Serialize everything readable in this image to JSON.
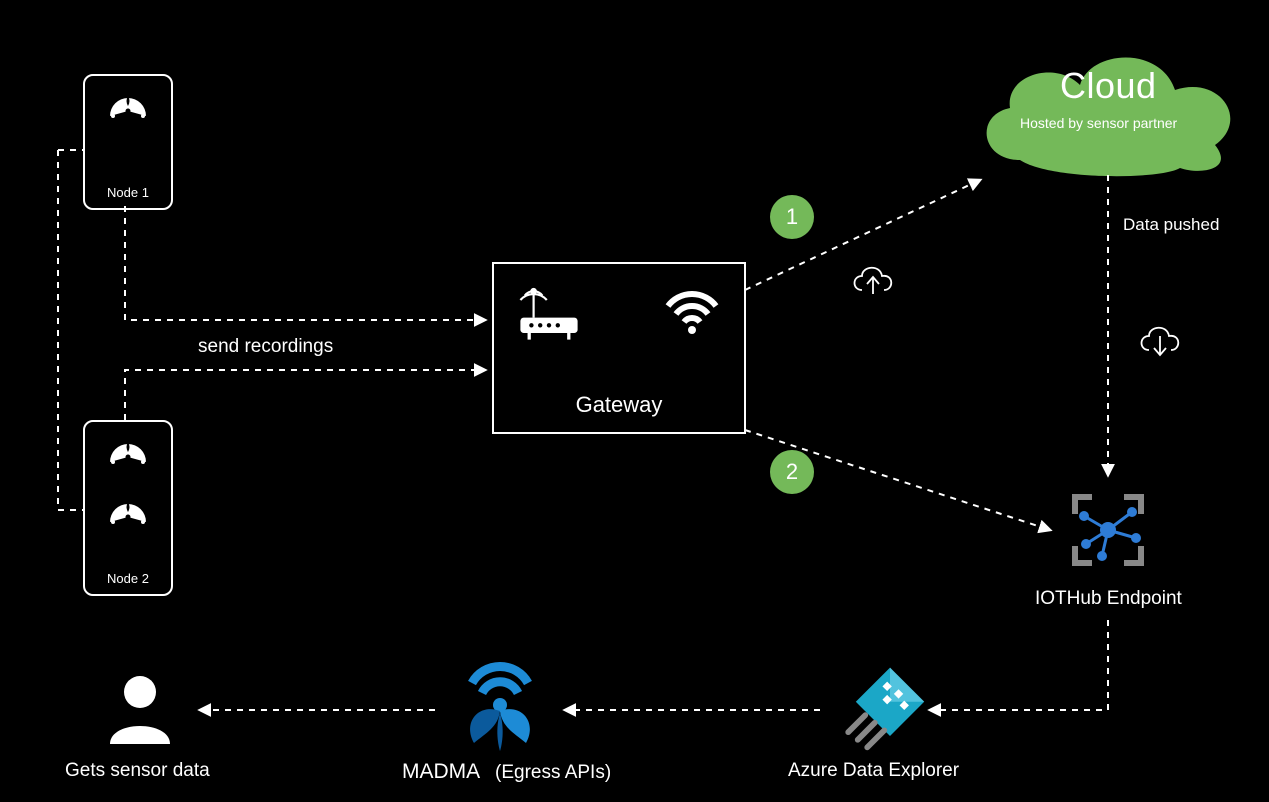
{
  "nodes": {
    "node1": "Node 1",
    "node2": "Node 2"
  },
  "gateway": {
    "label": "Gateway"
  },
  "cloud": {
    "title": "Cloud",
    "subtitle": "Hosted by sensor partner"
  },
  "iothub": {
    "label": "IOTHub Endpoint"
  },
  "ade": {
    "label": "Azure Data Explorer"
  },
  "madma": {
    "label": "MADMA",
    "suffix": "(Egress APIs)"
  },
  "user": {
    "label": "Gets sensor data"
  },
  "arrows": {
    "send_recordings": "send recordings",
    "data_pushed": "Data pushed"
  },
  "steps": {
    "one": "1",
    "two": "2"
  }
}
